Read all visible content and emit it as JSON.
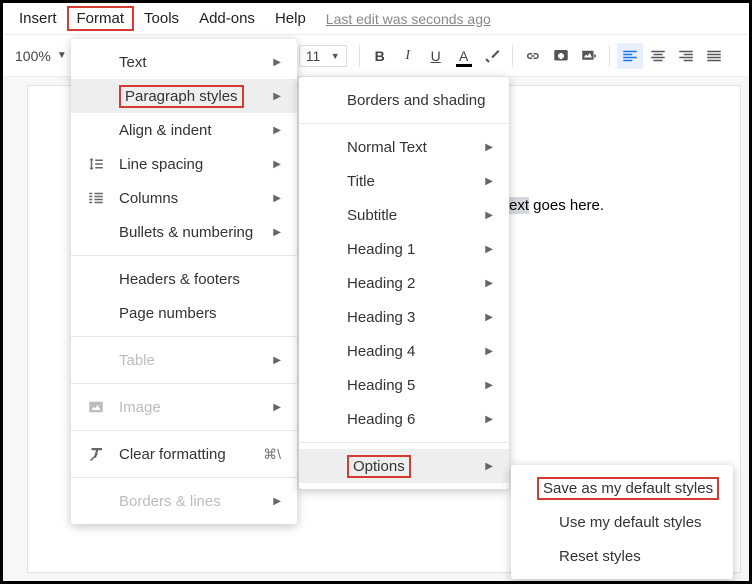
{
  "menubar": {
    "items": [
      "Insert",
      "Format",
      "Tools",
      "Add-ons",
      "Help"
    ],
    "active_index": 1,
    "edit_status": "Last edit was seconds ago"
  },
  "toolbar": {
    "zoom": "100%",
    "font_size": "11"
  },
  "document": {
    "visible_text_prefix": "ext",
    "visible_text_rest": " goes here."
  },
  "format_menu": {
    "items": [
      {
        "label": "Text",
        "icon": null,
        "submenu": true
      },
      {
        "label": "Paragraph styles",
        "icon": null,
        "submenu": true,
        "hovered": true,
        "redbox": true
      },
      {
        "label": "Align & indent",
        "icon": null,
        "submenu": true
      },
      {
        "label": "Line spacing",
        "icon": "line-spacing",
        "submenu": true
      },
      {
        "label": "Columns",
        "icon": "columns",
        "submenu": true
      },
      {
        "label": "Bullets & numbering",
        "icon": null,
        "submenu": true
      },
      {
        "divider": true
      },
      {
        "label": "Headers & footers",
        "icon": null
      },
      {
        "label": "Page numbers",
        "icon": null
      },
      {
        "divider": true
      },
      {
        "label": "Table",
        "icon": null,
        "submenu": true,
        "disabled": true
      },
      {
        "divider": true
      },
      {
        "label": "Image",
        "icon": "image",
        "submenu": true,
        "disabled": true
      },
      {
        "divider": true
      },
      {
        "label": "Clear formatting",
        "icon": "clear-format",
        "shortcut": "⌘\\"
      },
      {
        "divider": true
      },
      {
        "label": "Borders & lines",
        "icon": null,
        "submenu": true,
        "disabled": true
      }
    ]
  },
  "para_menu": {
    "items": [
      {
        "label": "Borders and shading"
      },
      {
        "divider": true
      },
      {
        "label": "Normal Text",
        "submenu": true
      },
      {
        "label": "Title",
        "submenu": true
      },
      {
        "label": "Subtitle",
        "submenu": true
      },
      {
        "label": "Heading 1",
        "submenu": true
      },
      {
        "label": "Heading 2",
        "submenu": true
      },
      {
        "label": "Heading 3",
        "submenu": true
      },
      {
        "label": "Heading 4",
        "submenu": true
      },
      {
        "label": "Heading 5",
        "submenu": true
      },
      {
        "label": "Heading 6",
        "submenu": true
      },
      {
        "divider": true
      },
      {
        "label": "Options",
        "submenu": true,
        "hovered": true,
        "redbox": true
      }
    ]
  },
  "opts_menu": {
    "items": [
      {
        "label": "Save as my default styles",
        "redbox": true
      },
      {
        "label": "Use my default styles"
      },
      {
        "label": "Reset styles"
      }
    ]
  }
}
